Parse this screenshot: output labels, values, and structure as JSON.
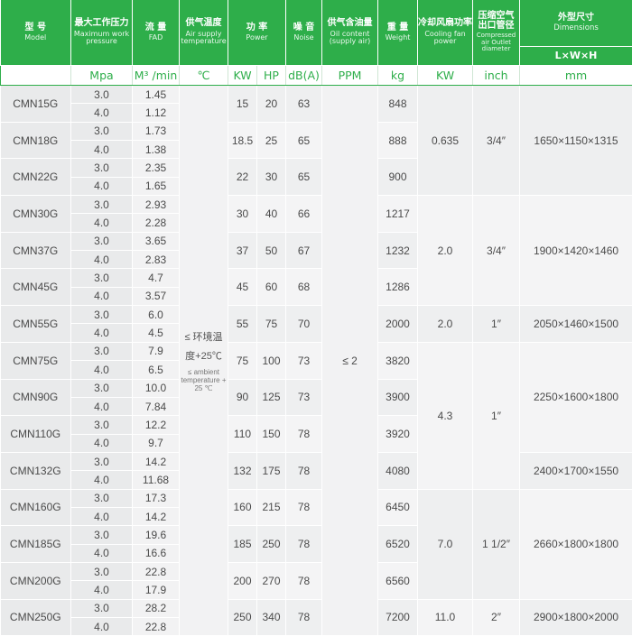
{
  "header": {
    "model": {
      "cn": "型 号",
      "en": "Model"
    },
    "pressure": {
      "cn": "最大工作压力",
      "en": "Maximum work pressure",
      "unit": "Mpa"
    },
    "fad": {
      "cn": "流 量",
      "en": "FAD",
      "unit": "M³ /min"
    },
    "temp": {
      "cn": "供气温度",
      "en": "Air supply temperature",
      "unit": "℃"
    },
    "power": {
      "cn": "功 率",
      "en": "Power",
      "unit_kw": "KW",
      "unit_hp": "HP"
    },
    "noise": {
      "cn": "噪 音",
      "en": "Noise",
      "unit": "dB(A)"
    },
    "oil": {
      "cn": "供气含油量",
      "en": "Oil content (supply air)",
      "unit": "PPM"
    },
    "weight": {
      "cn": "重 量",
      "en": "Weight",
      "unit": "kg"
    },
    "fan": {
      "cn": "冷却风扇功率",
      "en": "Cooling fan power",
      "unit": "KW"
    },
    "outlet": {
      "cn": "压缩空气 出口管径",
      "en": "Compressed air Outlet diameter",
      "unit": "inch"
    },
    "dimensions": {
      "cn": "外型尺寸",
      "en": "Dimensions",
      "sub": "L×W×H",
      "unit": "mm"
    }
  },
  "shared": {
    "temp_cn": "≤ 环境温度+25℃",
    "temp_en": "≤ ambient temperature + 25 ℃",
    "oil": "≤ 2"
  },
  "rows": [
    {
      "model": "CMN15G",
      "p1": "3.0",
      "f1": "1.45",
      "p2": "4.0",
      "f2": "1.12",
      "kw": "15",
      "hp": "20",
      "db": "63",
      "kg": "848"
    },
    {
      "model": "CMN18G",
      "p1": "3.0",
      "f1": "1.73",
      "p2": "4.0",
      "f2": "1.38",
      "kw": "18.5",
      "hp": "25",
      "db": "65",
      "kg": "888"
    },
    {
      "model": "CMN22G",
      "p1": "3.0",
      "f1": "2.35",
      "p2": "4.0",
      "f2": "1.65",
      "kw": "22",
      "hp": "30",
      "db": "65",
      "kg": "900"
    },
    {
      "model": "CMN30G",
      "p1": "3.0",
      "f1": "2.93",
      "p2": "4.0",
      "f2": "2.28",
      "kw": "30",
      "hp": "40",
      "db": "66",
      "kg": "1217"
    },
    {
      "model": "CMN37G",
      "p1": "3.0",
      "f1": "3.65",
      "p2": "4.0",
      "f2": "2.83",
      "kw": "37",
      "hp": "50",
      "db": "67",
      "kg": "1232"
    },
    {
      "model": "CMN45G",
      "p1": "3.0",
      "f1": "4.7",
      "p2": "4.0",
      "f2": "3.57",
      "kw": "45",
      "hp": "60",
      "db": "68",
      "kg": "1286"
    },
    {
      "model": "CMN55G",
      "p1": "3.0",
      "f1": "6.0",
      "p2": "4.0",
      "f2": "4.5",
      "kw": "55",
      "hp": "75",
      "db": "70",
      "kg": "2000"
    },
    {
      "model": "CMN75G",
      "p1": "3.0",
      "f1": "7.9",
      "p2": "4.0",
      "f2": "6.5",
      "kw": "75",
      "hp": "100",
      "db": "73",
      "kg": "3820"
    },
    {
      "model": "CMN90G",
      "p1": "3.0",
      "f1": "10.0",
      "p2": "4.0",
      "f2": "7.84",
      "kw": "90",
      "hp": "125",
      "db": "73",
      "kg": "3900"
    },
    {
      "model": "CMN110G",
      "p1": "3.0",
      "f1": "12.2",
      "p2": "4.0",
      "f2": "9.7",
      "kw": "110",
      "hp": "150",
      "db": "78",
      "kg": "3920"
    },
    {
      "model": "CMN132G",
      "p1": "3.0",
      "f1": "14.2",
      "p2": "4.0",
      "f2": "11.68",
      "kw": "132",
      "hp": "175",
      "db": "78",
      "kg": "4080"
    },
    {
      "model": "CMN160G",
      "p1": "3.0",
      "f1": "17.3",
      "p2": "4.0",
      "f2": "14.2",
      "kw": "160",
      "hp": "215",
      "db": "78",
      "kg": "6450"
    },
    {
      "model": "CMN185G",
      "p1": "3.0",
      "f1": "19.6",
      "p2": "4.0",
      "f2": "16.6",
      "kw": "185",
      "hp": "250",
      "db": "78",
      "kg": "6520"
    },
    {
      "model": "CMN200G",
      "p1": "3.0",
      "f1": "22.8",
      "p2": "4.0",
      "f2": "17.9",
      "kw": "200",
      "hp": "270",
      "db": "78",
      "kg": "6560"
    },
    {
      "model": "CMN250G",
      "p1": "3.0",
      "f1": "28.2",
      "p2": "4.0",
      "f2": "22.8",
      "kw": "250",
      "hp": "340",
      "db": "78",
      "kg": "7200"
    }
  ],
  "groups": {
    "fan": [
      "0.635",
      "2.0",
      "2.0",
      "4.3",
      "7.0",
      "11.0"
    ],
    "outlet": [
      "3/4″",
      "3/4″",
      "1″",
      "1″",
      "1  1/2″",
      "2″"
    ],
    "dims": [
      "1650×1150×1315",
      "1900×1420×1460",
      "2050×1460×1500",
      "2250×1600×1800",
      "2400×1700×1550",
      "2660×1800×1800",
      "2900×1800×2000"
    ]
  }
}
